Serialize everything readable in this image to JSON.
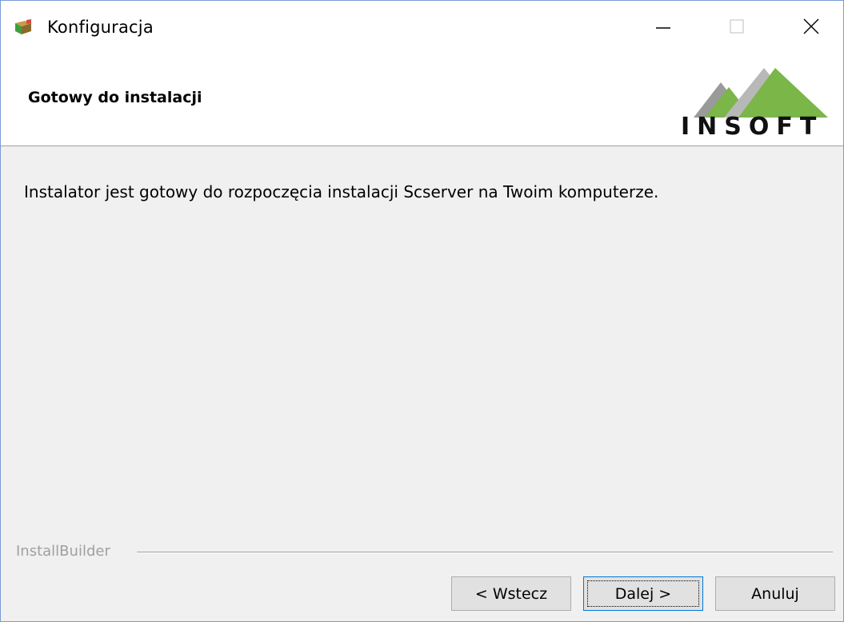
{
  "window": {
    "title": "Konfiguracja"
  },
  "titlebar_buttons": {
    "minimize_icon": "minimize-icon",
    "maximize_icon": "maximize-icon",
    "close_icon": "close-icon"
  },
  "header": {
    "title": "Gotowy do instalacji",
    "logo_text": "INSOFT"
  },
  "content": {
    "message": "Instalator jest gotowy do rozpoczęcia instalacji Scserver na Twoim komputerze."
  },
  "branding": {
    "label": "InstallBuilder"
  },
  "buttons": {
    "back_label": "< Wstecz",
    "next_label": "Dalej >",
    "cancel_label": "Anuluj"
  },
  "colors": {
    "window_border": "#7a9bd6",
    "logo_green": "#7ab648",
    "logo_gray": "#9a9a9a",
    "focus_border": "#0078d7"
  }
}
